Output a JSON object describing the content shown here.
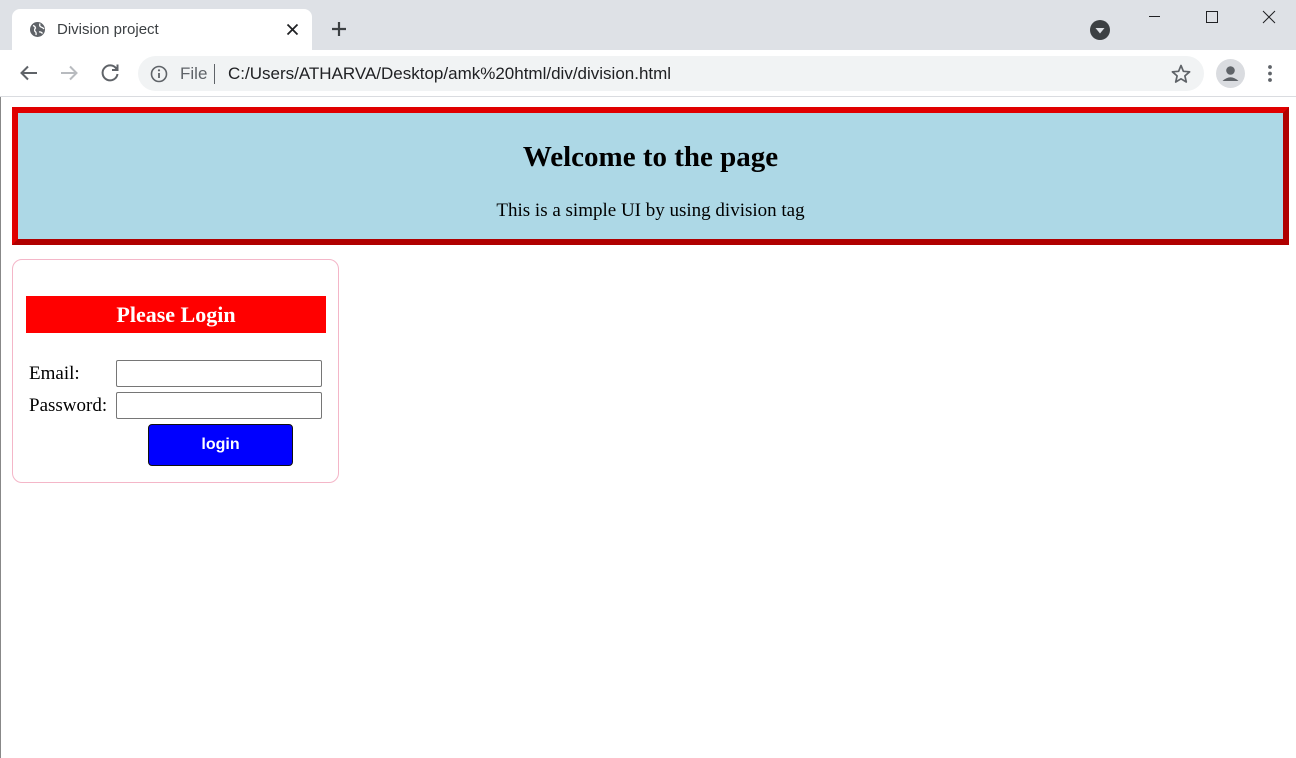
{
  "browser": {
    "tab_title": "Division project",
    "address": {
      "scheme_label": "File",
      "url": "C:/Users/ATHARVA/Desktop/amk%20html/div/division.html"
    },
    "icons": {
      "favicon": "globe-icon",
      "tab_close": "close-icon",
      "new_tab": "plus-icon",
      "media": "media-control-icon",
      "back": "arrow-left-icon",
      "forward": "arrow-right-icon",
      "reload": "reload-icon",
      "site_info": "info-icon",
      "bookmark": "star-icon",
      "profile": "person-icon",
      "menu": "more-vertical-icon"
    }
  },
  "page": {
    "header": {
      "title": "Welcome to the page",
      "subtitle": "This is a simple UI by using division tag"
    },
    "login": {
      "title": "Please Login",
      "email_label": "Email:",
      "email_value": "",
      "password_label": "Password:",
      "password_value": "",
      "button_label": "login"
    }
  },
  "colors": {
    "header_bg": "#add8e6",
    "header_border": "#e00000",
    "login_title_bg": "#ff0000",
    "login_button_bg": "#0000ff",
    "login_box_border": "#f4b6c8"
  }
}
